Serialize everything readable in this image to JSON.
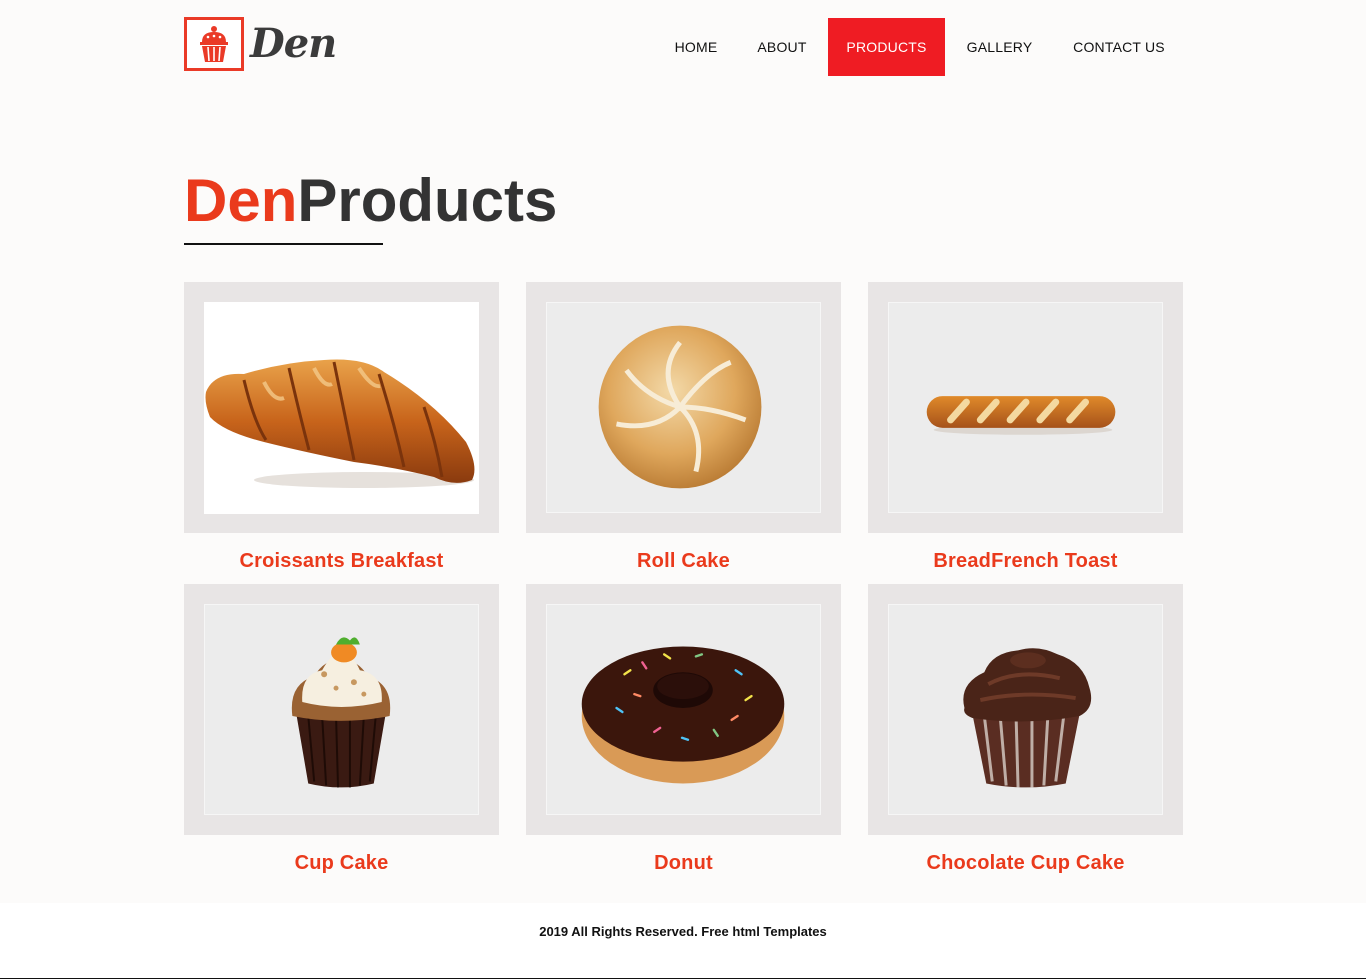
{
  "header": {
    "logo_text": "Den",
    "logo_icon": "cupcake-icon",
    "nav": [
      {
        "label": "HOME"
      },
      {
        "label": "ABOUT"
      },
      {
        "label": "PRODUCTS",
        "active": true
      },
      {
        "label": "GALLERY"
      },
      {
        "label": "CONTACT US"
      }
    ]
  },
  "colors": {
    "accent": "#ea3a1c",
    "nav_active": "#ef1c23",
    "title_dark": "#333333",
    "card_frame": "#e8e5e5"
  },
  "main": {
    "title_accent": "Den",
    "title_rest": "Products",
    "products": [
      {
        "name": "Croissants Breakfast",
        "image": "croissant-image"
      },
      {
        "name": "Roll Cake",
        "image": "bread-roll-image"
      },
      {
        "name": "BreadFrench Toast",
        "image": "baguette-image"
      },
      {
        "name": "Cup Cake",
        "image": "cupcake-image"
      },
      {
        "name": "Donut",
        "image": "donut-image"
      },
      {
        "name": "Chocolate Cup Cake",
        "image": "chocolate-cupcake-image"
      }
    ]
  },
  "footer": {
    "text": "2019 All Rights Reserved. Free html Templates"
  }
}
